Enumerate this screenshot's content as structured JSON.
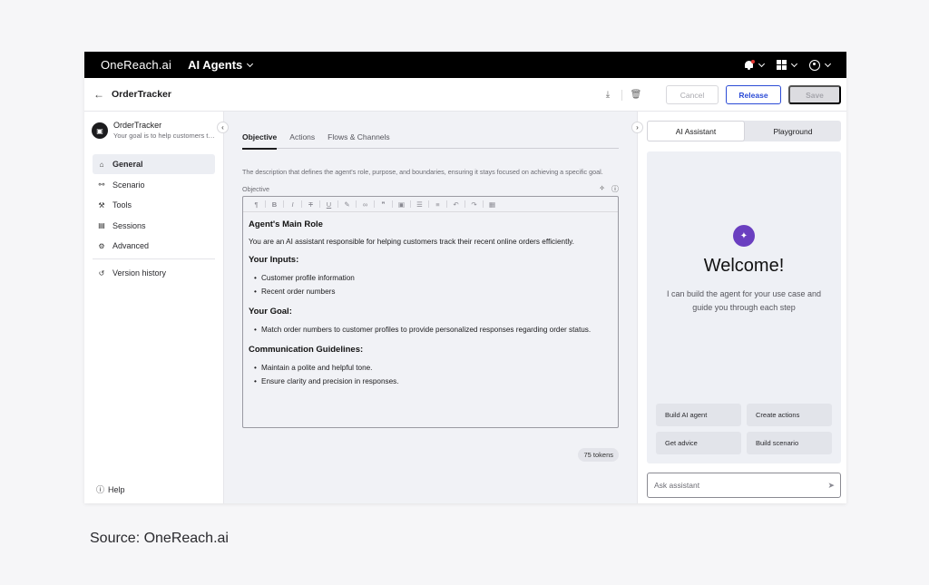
{
  "topbar": {
    "brand": "OneReach.ai",
    "app_name": "AI Agents"
  },
  "header": {
    "title": "OrderTracker",
    "cancel_label": "Cancel",
    "release_label": "Release",
    "save_label": "Save"
  },
  "sidebar": {
    "agent_name": "OrderTracker",
    "agent_desc": "Your goal is to help customers track their recent online orders",
    "items": [
      {
        "label": "General",
        "icon": "home-icon"
      },
      {
        "label": "Scenario",
        "icon": "flow-icon"
      },
      {
        "label": "Tools",
        "icon": "tools-icon"
      },
      {
        "label": "Sessions",
        "icon": "chat-icon"
      },
      {
        "label": "Advanced",
        "icon": "gear-icon"
      }
    ],
    "version_history": "Version history",
    "help": "Help"
  },
  "main": {
    "tabs": [
      "Objective",
      "Actions",
      "Flows & Channels"
    ],
    "description": "The description that defines the agent's role, purpose, and boundaries, ensuring it stays focused on achieving a specific goal.",
    "field_label": "Objective",
    "editor": {
      "h1": "Agent's Main Role",
      "p1": "You are an AI assistant responsible for helping customers track their recent online orders efficiently.",
      "h2": "Your Inputs:",
      "inputs": [
        "Customer profile information",
        "Recent order numbers"
      ],
      "h3": "Your Goal:",
      "goals": [
        "Match order numbers to customer profiles to provide personalized responses regarding order status."
      ],
      "h4": "Communication Guidelines:",
      "guidelines": [
        "Maintain a polite and helpful tone.",
        "Ensure clarity and precision in responses."
      ]
    },
    "tokens": "75 tokens"
  },
  "right": {
    "tabs": [
      "AI Assistant",
      "Playground"
    ],
    "welcome": "Welcome!",
    "welcome_sub": "I can build the agent for your use case and guide you through each step",
    "chips": [
      "Build AI agent",
      "Create actions",
      "Get advice",
      "Build scenario"
    ],
    "ask_placeholder": "Ask assistant"
  },
  "source": "Source: OneReach.ai"
}
